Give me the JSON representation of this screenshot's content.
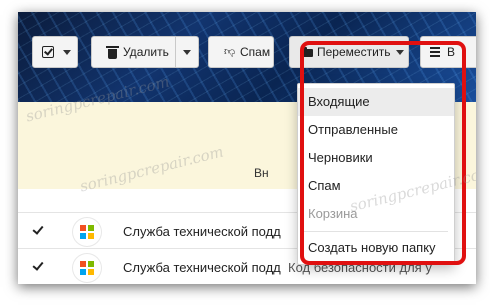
{
  "toolbar": {
    "delete_label": "Удалить",
    "spam_label": "Спам",
    "move_label": "Переместить",
    "more_label_partial": "В"
  },
  "notice": {
    "text_partial": "Вн"
  },
  "emails": [
    {
      "checked": true,
      "sender": "Служба технической подд",
      "subject": "",
      "logo": "microsoft-logo"
    },
    {
      "checked": true,
      "sender": "Служба технической подд",
      "subject": "Код безопасности для у",
      "logo": "microsoft-logo"
    }
  ],
  "move_menu": {
    "items": [
      {
        "label": "Входящие",
        "state": "hover"
      },
      {
        "label": "Отправленные",
        "state": "normal"
      },
      {
        "label": "Черновики",
        "state": "normal"
      },
      {
        "label": "Спам",
        "state": "normal"
      },
      {
        "label": "Корзина",
        "state": "disabled"
      }
    ],
    "create_label": "Создать новую папку"
  },
  "watermark": "soringpcrepair.com",
  "colors": {
    "highlight": "#e01010",
    "notice_bg": "#fbf6dc",
    "banner": "#12346e",
    "ms_red": "#f25022",
    "ms_green": "#7fba00",
    "ms_blue": "#00a4ef",
    "ms_yellow": "#ffb900"
  }
}
